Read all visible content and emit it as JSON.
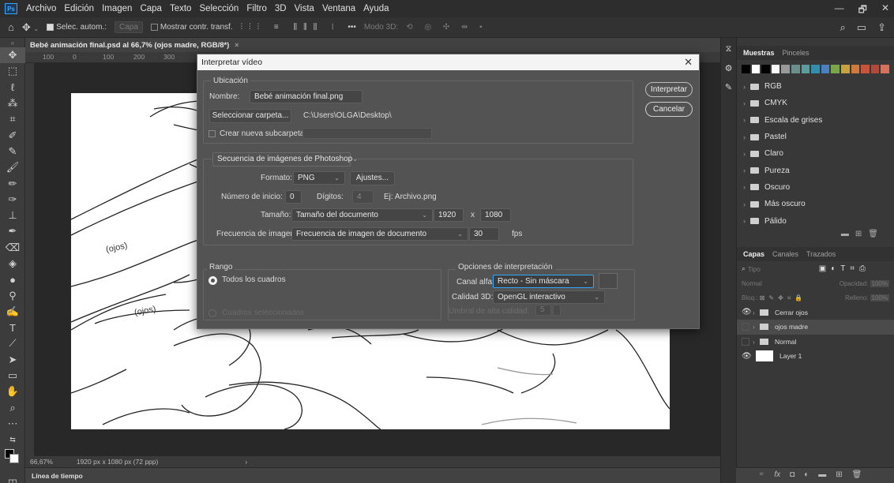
{
  "menu": {
    "logo": "Ps",
    "items": [
      "Archivo",
      "Edición",
      "Imagen",
      "Capa",
      "Texto",
      "Selección",
      "Filtro",
      "3D",
      "Vista",
      "Ventana",
      "Ayuda"
    ]
  },
  "window_controls": {
    "minimize": "—",
    "maximize": "🗗",
    "close": "✕"
  },
  "options_bar": {
    "auto_select_label": "Selec. autom.:",
    "auto_select_target": "Capa",
    "transform_controls_label": "Mostrar contr. transf.",
    "more": "•••",
    "mode_3d": "Modo 3D:"
  },
  "document": {
    "tab_title": "Bebé animación final.psd al 66,7% (ojos madre, RGB/8*)",
    "ruler_top_ticks": [
      "100",
      "0",
      "100",
      "200",
      "300"
    ],
    "zoom": "66,67%",
    "doc_info": "1920 px x 1080 px (72 ppp)",
    "canvas_text": [
      "(ojos)",
      "(ojos)"
    ]
  },
  "timeline": {
    "label": "Línea de tiempo"
  },
  "dialog": {
    "title": "Interpretar vídeo",
    "close": "✕",
    "location": {
      "group_label": "Ubicación",
      "name_label": "Nombre:",
      "name_value": "Bebé animación final.png",
      "select_folder_button": "Seleccionar carpeta...",
      "folder_path": "C:\\Users\\OLGA\\Desktop\\",
      "create_subfolder_label": "Crear nueva subcarpeta:"
    },
    "sequence": {
      "type": "Secuencia de imágenes de Photoshop",
      "format_label": "Formato:",
      "format_value": "PNG",
      "settings_button": "Ajustes...",
      "start_label": "Número de inicio:",
      "start_value": "0",
      "digits_label": "Dígitos:",
      "digits_value": "4",
      "example": "Ej: Archivo.png",
      "size_label": "Tamaño:",
      "size_value": "Tamaño del documento",
      "width": "1920",
      "x": "x",
      "height": "1080",
      "framerate_label": "Frecuencia de imagen:",
      "framerate_value": "Frecuencia de imagen de documento",
      "fps_value": "30",
      "fps_unit": "fps"
    },
    "range": {
      "group_label": "Rango",
      "all_frames": "Todos los cuadros",
      "selected_frames": "Cuadros seleccionados"
    },
    "render_options": {
      "group_label": "Opciones de interpretación",
      "alpha_label": "Canal alfa:",
      "alpha_value": "Recto - Sin máscara",
      "quality_3d_label": "Calidad 3D:",
      "quality_3d_value": "OpenGL interactivo",
      "high_quality_threshold_label": "Umbral de alta calidad:",
      "high_quality_threshold_value": "5"
    },
    "render_button": "Interpretar",
    "cancel_button": "Cancelar"
  },
  "swatches_panel": {
    "tabs": [
      "Muestras",
      "Pinceles"
    ],
    "colors": [
      "#000000",
      "#ffffff",
      "#000000",
      "#ffffff",
      "#9a9a9a",
      "#6b8f8a",
      "#5b9c9c",
      "#2e8fb0",
      "#4a7fc0",
      "#7aa64a",
      "#c8a23c",
      "#d07a3c",
      "#c8543c",
      "#b04a3c",
      "#d8705a"
    ],
    "folders": [
      "RGB",
      "CMYK",
      "Escala de grises",
      "Pastel",
      "Claro",
      "Pureza",
      "Oscuro",
      "Más oscuro",
      "Pálido"
    ]
  },
  "layers_panel": {
    "tabs": [
      "Capas",
      "Canales",
      "Trazados"
    ],
    "search_placeholder": "Tipo",
    "blend_mode": "Normal",
    "opacity_label": "Opacidad:",
    "opacity_value": "100%",
    "lock_label": "Bloq.:",
    "fill_label": "Relleno:",
    "fill_value": "100%",
    "layers": [
      {
        "name": "Cerrar ojos",
        "type": "group",
        "visible": true,
        "selected": false
      },
      {
        "name": "ojos madre",
        "type": "group",
        "visible": false,
        "selected": true
      },
      {
        "name": "Normal",
        "type": "group",
        "visible": false,
        "selected": false
      },
      {
        "name": "Layer 1",
        "type": "layer",
        "visible": true,
        "selected": false
      }
    ],
    "bottom_icons": [
      "link-icon",
      "fx-icon",
      "mask-icon",
      "adjustment-icon",
      "folder-icon",
      "new-layer-icon",
      "trash-icon"
    ],
    "fx": "fx"
  },
  "colors": {
    "accent": "#31a8ff",
    "dialog_bg": "#535353",
    "panel_bg": "#383838"
  }
}
